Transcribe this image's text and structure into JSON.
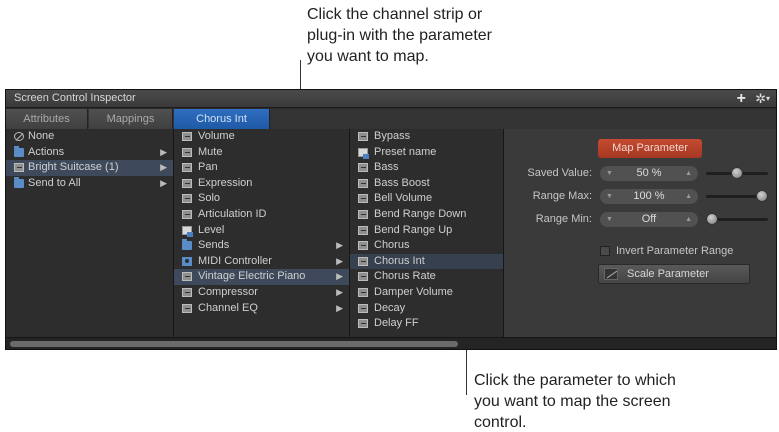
{
  "callouts": {
    "top": [
      "Click the channel strip or",
      "plug-in with the parameter",
      "you want to map."
    ],
    "bottom": [
      "Click the parameter to which",
      "you want to map the screen",
      "control."
    ]
  },
  "window": {
    "title": "Screen Control Inspector",
    "add_icon": "plus-icon",
    "menu_icon": "gear-icon"
  },
  "tabs": [
    {
      "label": "Attributes",
      "active": false
    },
    {
      "label": "Mappings",
      "active": false
    },
    {
      "label": "Chorus Int",
      "active": true
    }
  ],
  "column1": [
    {
      "label": "None",
      "icon": "none-icon",
      "submenu": false
    },
    {
      "label": "Actions",
      "icon": "folder-icon",
      "submenu": true
    },
    {
      "label": "Bright Suitcase (1)",
      "icon": "plugin-icon",
      "submenu": true,
      "selected": true
    },
    {
      "label": "Send to All",
      "icon": "folder-icon",
      "submenu": true
    }
  ],
  "column2": [
    {
      "label": "Volume",
      "icon": "plugin-icon",
      "submenu": false
    },
    {
      "label": "Mute",
      "icon": "plugin-icon",
      "submenu": false
    },
    {
      "label": "Pan",
      "icon": "plugin-icon",
      "submenu": false
    },
    {
      "label": "Expression",
      "icon": "plugin-icon",
      "submenu": false
    },
    {
      "label": "Solo",
      "icon": "plugin-icon",
      "submenu": false
    },
    {
      "label": "Articulation ID",
      "icon": "plugin-icon",
      "submenu": false
    },
    {
      "label": "Level",
      "icon": "document-icon",
      "submenu": false
    },
    {
      "label": "Sends",
      "icon": "folder-icon",
      "submenu": true
    },
    {
      "label": "MIDI Controller",
      "icon": "midi-icon",
      "submenu": true
    },
    {
      "label": "Vintage Electric Piano",
      "icon": "plugin-icon",
      "submenu": true,
      "selected": true
    },
    {
      "label": "Compressor",
      "icon": "plugin-icon",
      "submenu": true
    },
    {
      "label": "Channel EQ",
      "icon": "plugin-icon",
      "submenu": true
    }
  ],
  "column3": [
    {
      "label": "Bypass",
      "icon": "plugin-icon"
    },
    {
      "label": "Preset name",
      "icon": "document-icon"
    },
    {
      "label": "Bass",
      "icon": "plugin-icon"
    },
    {
      "label": "Bass Boost",
      "icon": "plugin-icon"
    },
    {
      "label": "Bell Volume",
      "icon": "plugin-icon"
    },
    {
      "label": "Bend Range Down",
      "icon": "plugin-icon"
    },
    {
      "label": "Bend Range Up",
      "icon": "plugin-icon"
    },
    {
      "label": "Chorus",
      "icon": "plugin-icon"
    },
    {
      "label": "Chorus Int",
      "icon": "plugin-icon",
      "highlight": true
    },
    {
      "label": "Chorus Rate",
      "icon": "plugin-icon"
    },
    {
      "label": "Damper Volume",
      "icon": "plugin-icon"
    },
    {
      "label": "Decay",
      "icon": "plugin-icon"
    },
    {
      "label": "Delay FF",
      "icon": "plugin-icon"
    }
  ],
  "inspector": {
    "map_button": "Map Parameter",
    "saved_value": {
      "label": "Saved Value:",
      "value": "50 %",
      "slider_fraction": 0.5
    },
    "range_max": {
      "label": "Range Max:",
      "value": "100 %",
      "slider_fraction": 1.0
    },
    "range_min": {
      "label": "Range Min:",
      "value": "Off",
      "slider_fraction": 0.0
    },
    "invert_label": "Invert Parameter Range",
    "invert_checked": false,
    "scale_button": "Scale Parameter"
  },
  "colors": {
    "accent_tab": "#1f5aa6",
    "map_button": "#b4422a",
    "panel_bg": "#2b2b2b"
  }
}
